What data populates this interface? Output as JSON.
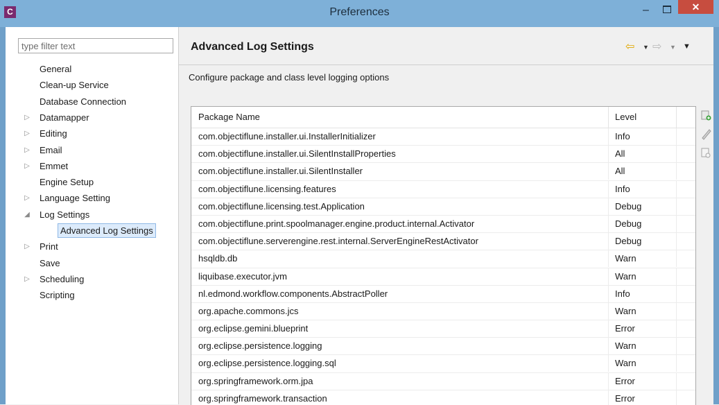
{
  "window": {
    "app_icon": "C",
    "title": "Preferences",
    "minimize_glyph": "–",
    "close_glyph": "✕"
  },
  "sidebar": {
    "filter_placeholder": "type filter text",
    "items": [
      {
        "label": "General",
        "expandable": false,
        "expanded": false,
        "level": 0
      },
      {
        "label": "Clean-up Service",
        "expandable": false,
        "expanded": false,
        "level": 0
      },
      {
        "label": "Database Connection",
        "expandable": false,
        "expanded": false,
        "level": 0
      },
      {
        "label": "Datamapper",
        "expandable": true,
        "expanded": false,
        "level": 0
      },
      {
        "label": "Editing",
        "expandable": true,
        "expanded": false,
        "level": 0
      },
      {
        "label": "Email",
        "expandable": true,
        "expanded": false,
        "level": 0
      },
      {
        "label": "Emmet",
        "expandable": true,
        "expanded": false,
        "level": 0
      },
      {
        "label": "Engine Setup",
        "expandable": false,
        "expanded": false,
        "level": 0
      },
      {
        "label": "Language Setting",
        "expandable": true,
        "expanded": false,
        "level": 0
      },
      {
        "label": "Log Settings",
        "expandable": true,
        "expanded": true,
        "level": 0
      },
      {
        "label": "Advanced Log Settings",
        "expandable": false,
        "expanded": false,
        "level": 1,
        "selected": true
      },
      {
        "label": "Print",
        "expandable": true,
        "expanded": false,
        "level": 0
      },
      {
        "label": "Save",
        "expandable": false,
        "expanded": false,
        "level": 0
      },
      {
        "label": "Scheduling",
        "expandable": true,
        "expanded": false,
        "level": 0
      },
      {
        "label": "Scripting",
        "expandable": false,
        "expanded": false,
        "level": 0
      }
    ]
  },
  "page": {
    "title": "Advanced Log Settings",
    "description": "Configure package and class level logging options",
    "nav": {
      "back_icon": "back-arrow-icon",
      "forward_icon": "forward-arrow-icon",
      "menu_icon": "view-menu-icon"
    }
  },
  "table": {
    "columns": [
      "Package Name",
      "Level"
    ],
    "rows": [
      {
        "package": "com.objectiflune.installer.ui.InstallerInitializer",
        "level": "Info"
      },
      {
        "package": "com.objectiflune.installer.ui.SilentInstallProperties",
        "level": "All"
      },
      {
        "package": "com.objectiflune.installer.ui.SilentInstaller",
        "level": "All"
      },
      {
        "package": "com.objectiflune.licensing.features",
        "level": "Info"
      },
      {
        "package": "com.objectiflune.licensing.test.Application",
        "level": "Debug"
      },
      {
        "package": "com.objectiflune.print.spoolmanager.engine.product.internal.Activator",
        "level": "Debug"
      },
      {
        "package": "com.objectiflune.serverengine.rest.internal.ServerEngineRestActivator",
        "level": "Debug"
      },
      {
        "package": "hsqldb.db",
        "level": "Warn"
      },
      {
        "package": "liquibase.executor.jvm",
        "level": "Warn"
      },
      {
        "package": "nl.edmond.workflow.components.AbstractPoller",
        "level": "Info"
      },
      {
        "package": "org.apache.commons.jcs",
        "level": "Warn"
      },
      {
        "package": "org.eclipse.gemini.blueprint",
        "level": "Error"
      },
      {
        "package": "org.eclipse.persistence.logging",
        "level": "Warn"
      },
      {
        "package": "org.eclipse.persistence.logging.sql",
        "level": "Warn"
      },
      {
        "package": "org.springframework.orm.jpa",
        "level": "Error"
      },
      {
        "package": "org.springframework.transaction",
        "level": "Error"
      }
    ]
  },
  "tools": {
    "add_icon": "add-entry-icon",
    "edit_icon": "edit-pencil-icon",
    "remove_icon": "remove-entry-icon"
  },
  "colors": {
    "titlebar": "#7eb0d8",
    "close_button": "#c74d3f",
    "selection_bg": "#dcebfb",
    "selection_border": "#8fb8e6",
    "back_arrow": "#e0a800"
  }
}
